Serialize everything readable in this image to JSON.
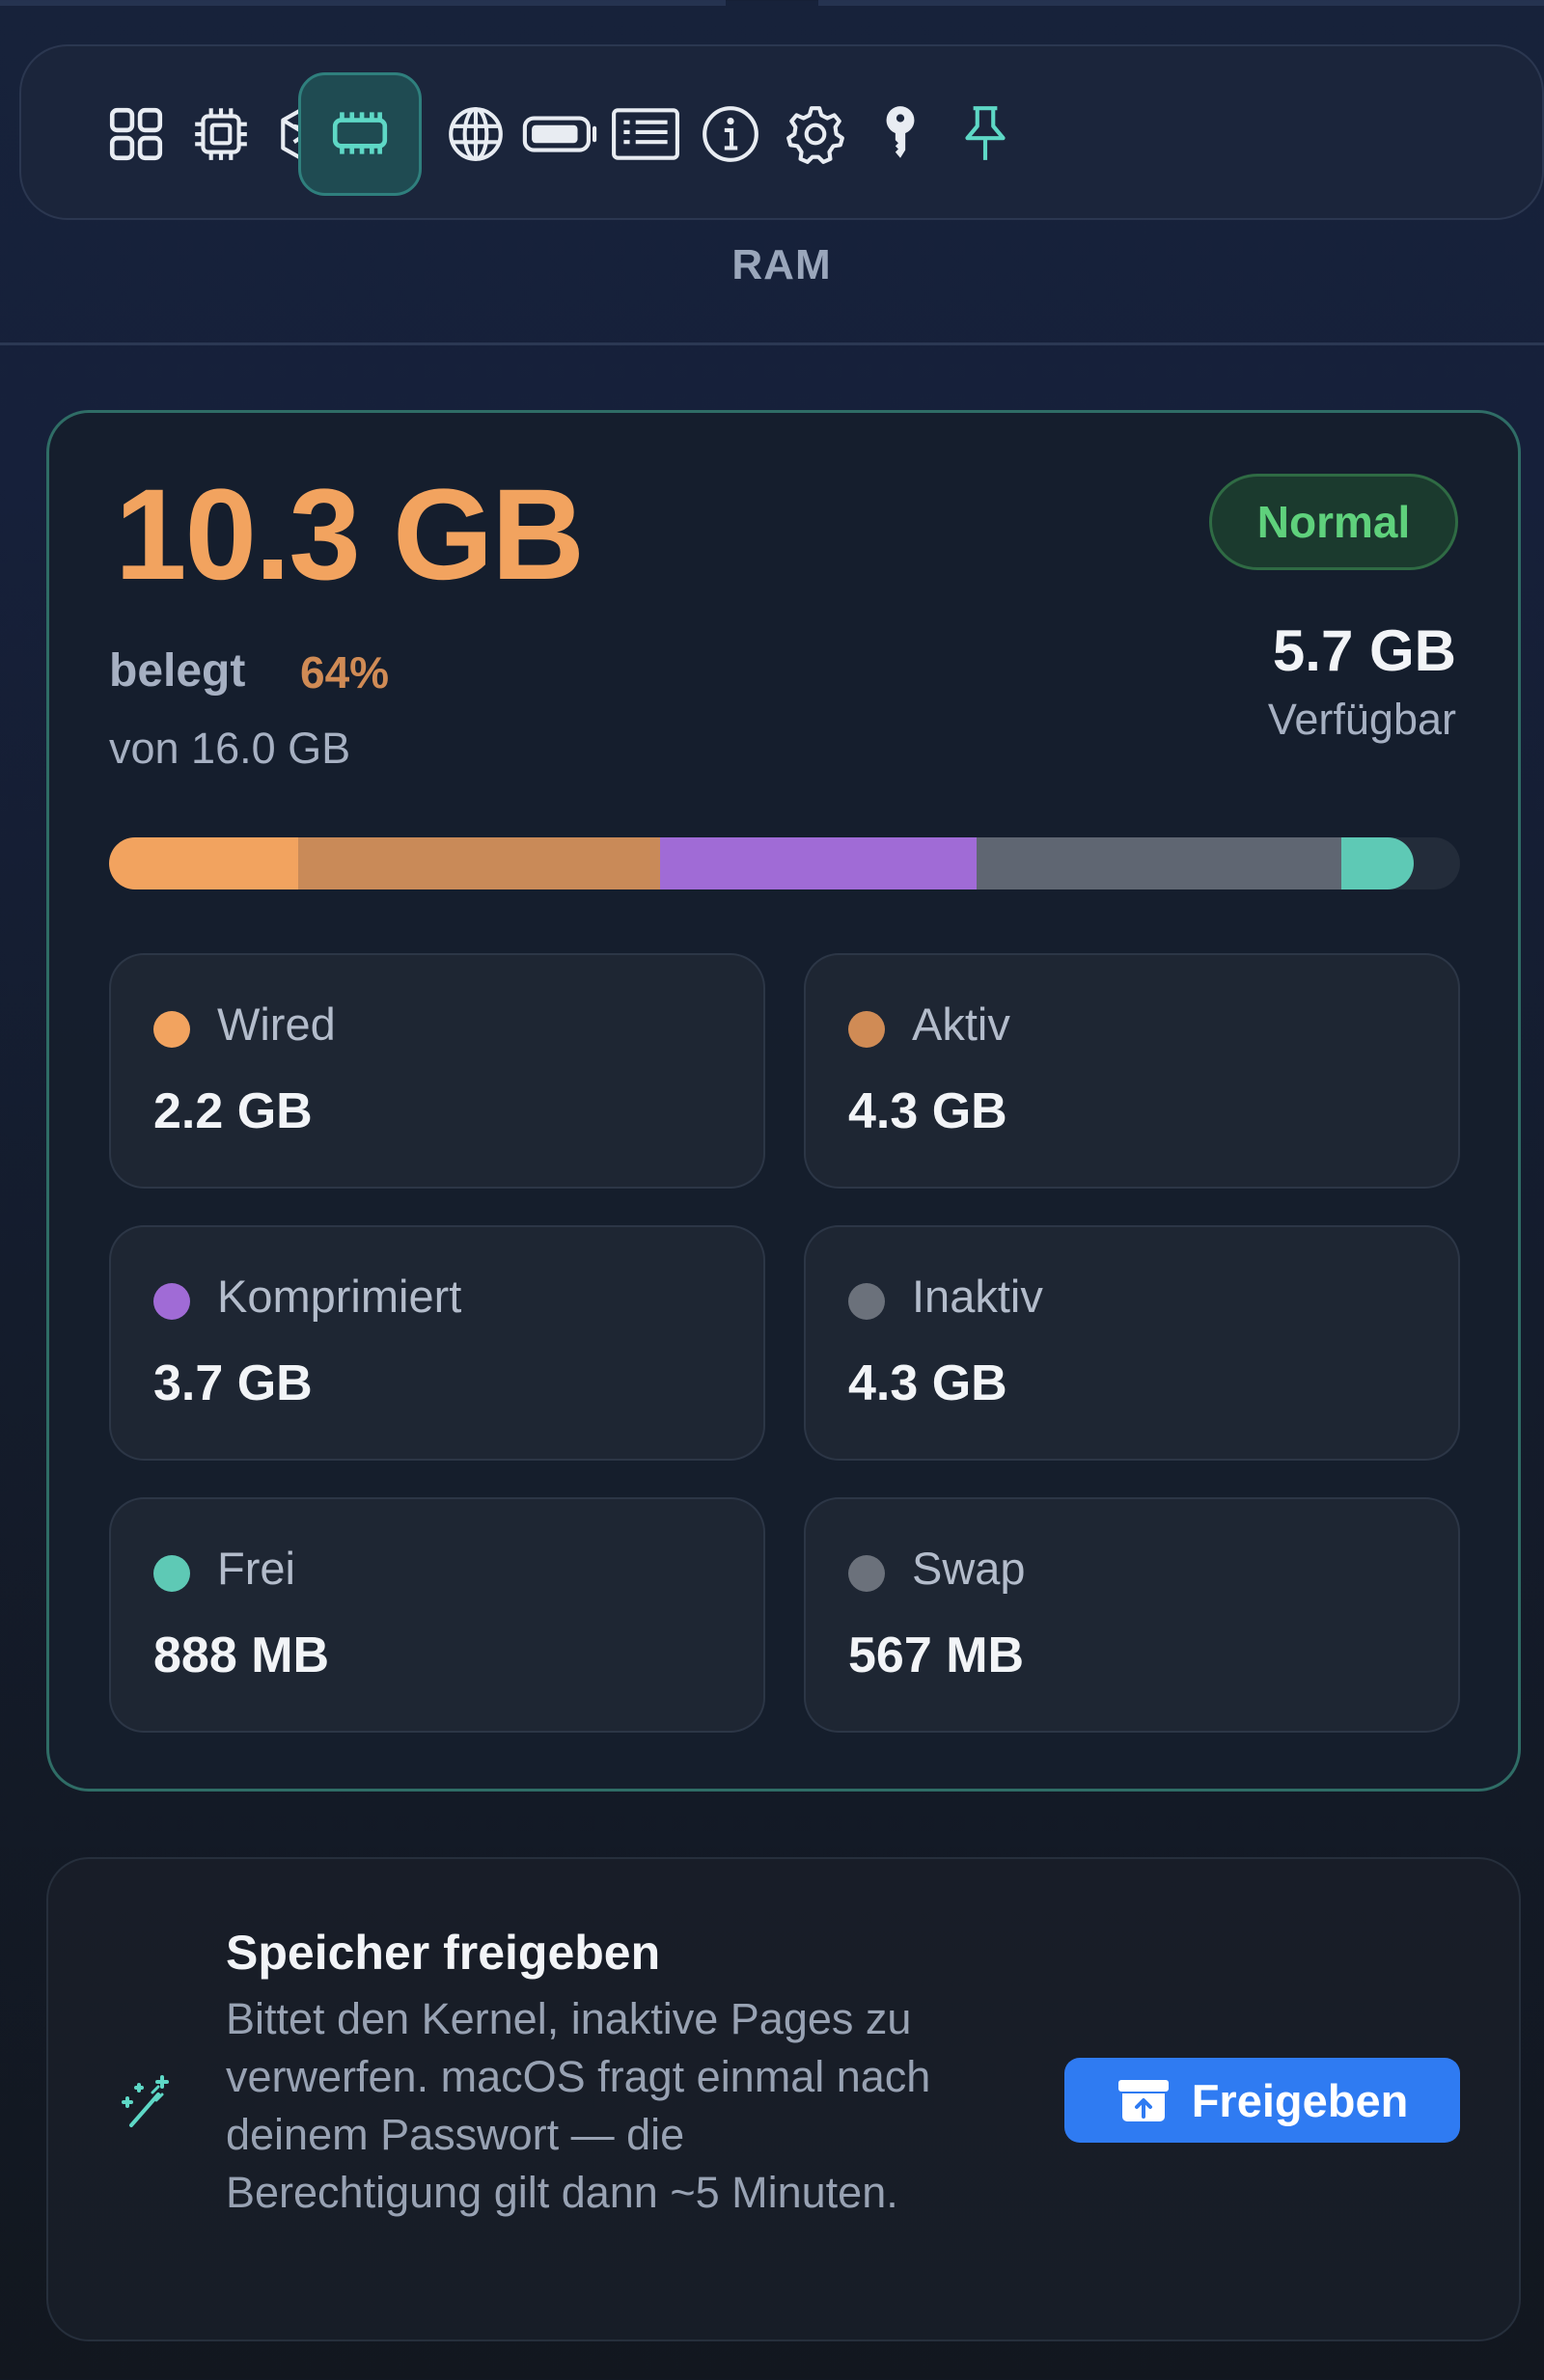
{
  "toolbar": {
    "items": [
      {
        "icon": "grid-icon",
        "label": ""
      },
      {
        "icon": "cpu-icon",
        "label": ""
      },
      {
        "icon": "gpu-cube-icon",
        "label": ""
      },
      {
        "icon": "ram-chip-icon",
        "label": "",
        "active": true
      },
      {
        "icon": "globe-icon",
        "label": ""
      },
      {
        "icon": "battery-icon",
        "label": ""
      },
      {
        "icon": "process-list-icon",
        "label": ""
      },
      {
        "icon": "info-icon",
        "label": ""
      },
      {
        "icon": "gear-icon",
        "label": ""
      },
      {
        "icon": "key-icon",
        "label": ""
      },
      {
        "icon": "pin-icon",
        "label": ""
      }
    ],
    "active_tab_label": "RAM"
  },
  "memory": {
    "used": "10.3 GB",
    "used_label": "belegt",
    "used_percent": "64%",
    "total": "von 16.0 GB",
    "status": "Normal",
    "available": "5.7 GB",
    "available_label": "Verfügbar",
    "bar_segments": [
      {
        "name": "Wired",
        "fraction": 0.14,
        "color": "#f2a35f"
      },
      {
        "name": "Aktiv",
        "fraction": 0.268,
        "color": "#c98a58"
      },
      {
        "name": "Komprimiert",
        "fraction": 0.234,
        "color": "#a06bd6"
      },
      {
        "name": "Inaktiv",
        "fraction": 0.27,
        "color": "#5f6672"
      },
      {
        "name": "Frei",
        "fraction": 0.054,
        "color": "#5ec9b5"
      }
    ],
    "stats": [
      {
        "label": "Wired",
        "value": "2.2 GB",
        "color": "#f2a35f"
      },
      {
        "label": "Aktiv",
        "value": "4.3 GB",
        "color": "#d08b55"
      },
      {
        "label": "Komprimiert",
        "value": "3.7 GB",
        "color": "#a06bd6"
      },
      {
        "label": "Inaktiv",
        "value": "4.3 GB",
        "color": "#6b717b"
      },
      {
        "label": "Frei",
        "value": "888 MB",
        "color": "#5ec9b5"
      },
      {
        "label": "Swap",
        "value": "567 MB",
        "color": "#6b717b"
      }
    ]
  },
  "free_memory": {
    "icon": "magic-wand-icon",
    "title": "Speicher freigeben",
    "description": "Bittet den Kernel, inaktive Pages zu verwerfen. macOS fragt einmal nach deinem Passwort — die Berechtigung gilt dann ~5 Minuten.",
    "button_label": "Freigeben",
    "button_icon": "archive-box-icon"
  },
  "colors": {
    "accent_teal": "#5ec9b5",
    "used_orange": "#f2a35f",
    "status_green": "#5fd17c",
    "button_blue": "#2f7bf2"
  }
}
